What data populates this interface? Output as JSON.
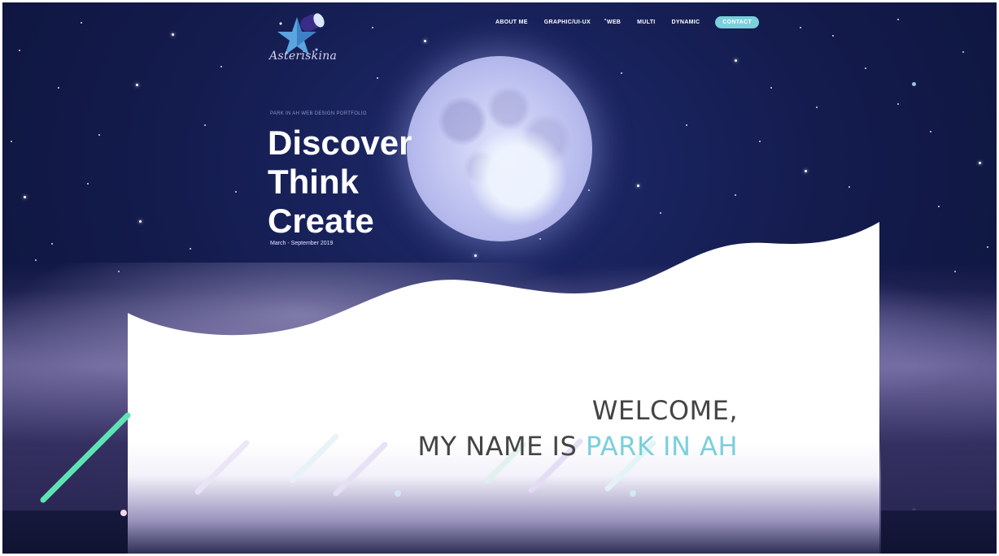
{
  "brand": {
    "logo_text": "Asteriskina"
  },
  "nav": {
    "items": [
      {
        "label": "ABOUT ME"
      },
      {
        "label": "GRAPHIC/UI-UX"
      },
      {
        "label": "WEB"
      },
      {
        "label": "MULTI"
      },
      {
        "label": "DYNAMIC"
      }
    ],
    "contact_label": "CONTACT"
  },
  "hero": {
    "kicker": "PARK IN AH WEB DESIGN PORTFOLIO",
    "lines": [
      "Discover",
      "Think",
      "Create"
    ],
    "date": "March - September 2019"
  },
  "welcome": {
    "line1": "WELCOME,",
    "line2_prefix": "MY NAME IS ",
    "line2_name": "PARK IN AH"
  },
  "colors": {
    "accent": "#7ccfdc",
    "text_dark": "#444444",
    "streak_green": "#5fe3b4",
    "night_blue": "#141c4f"
  }
}
